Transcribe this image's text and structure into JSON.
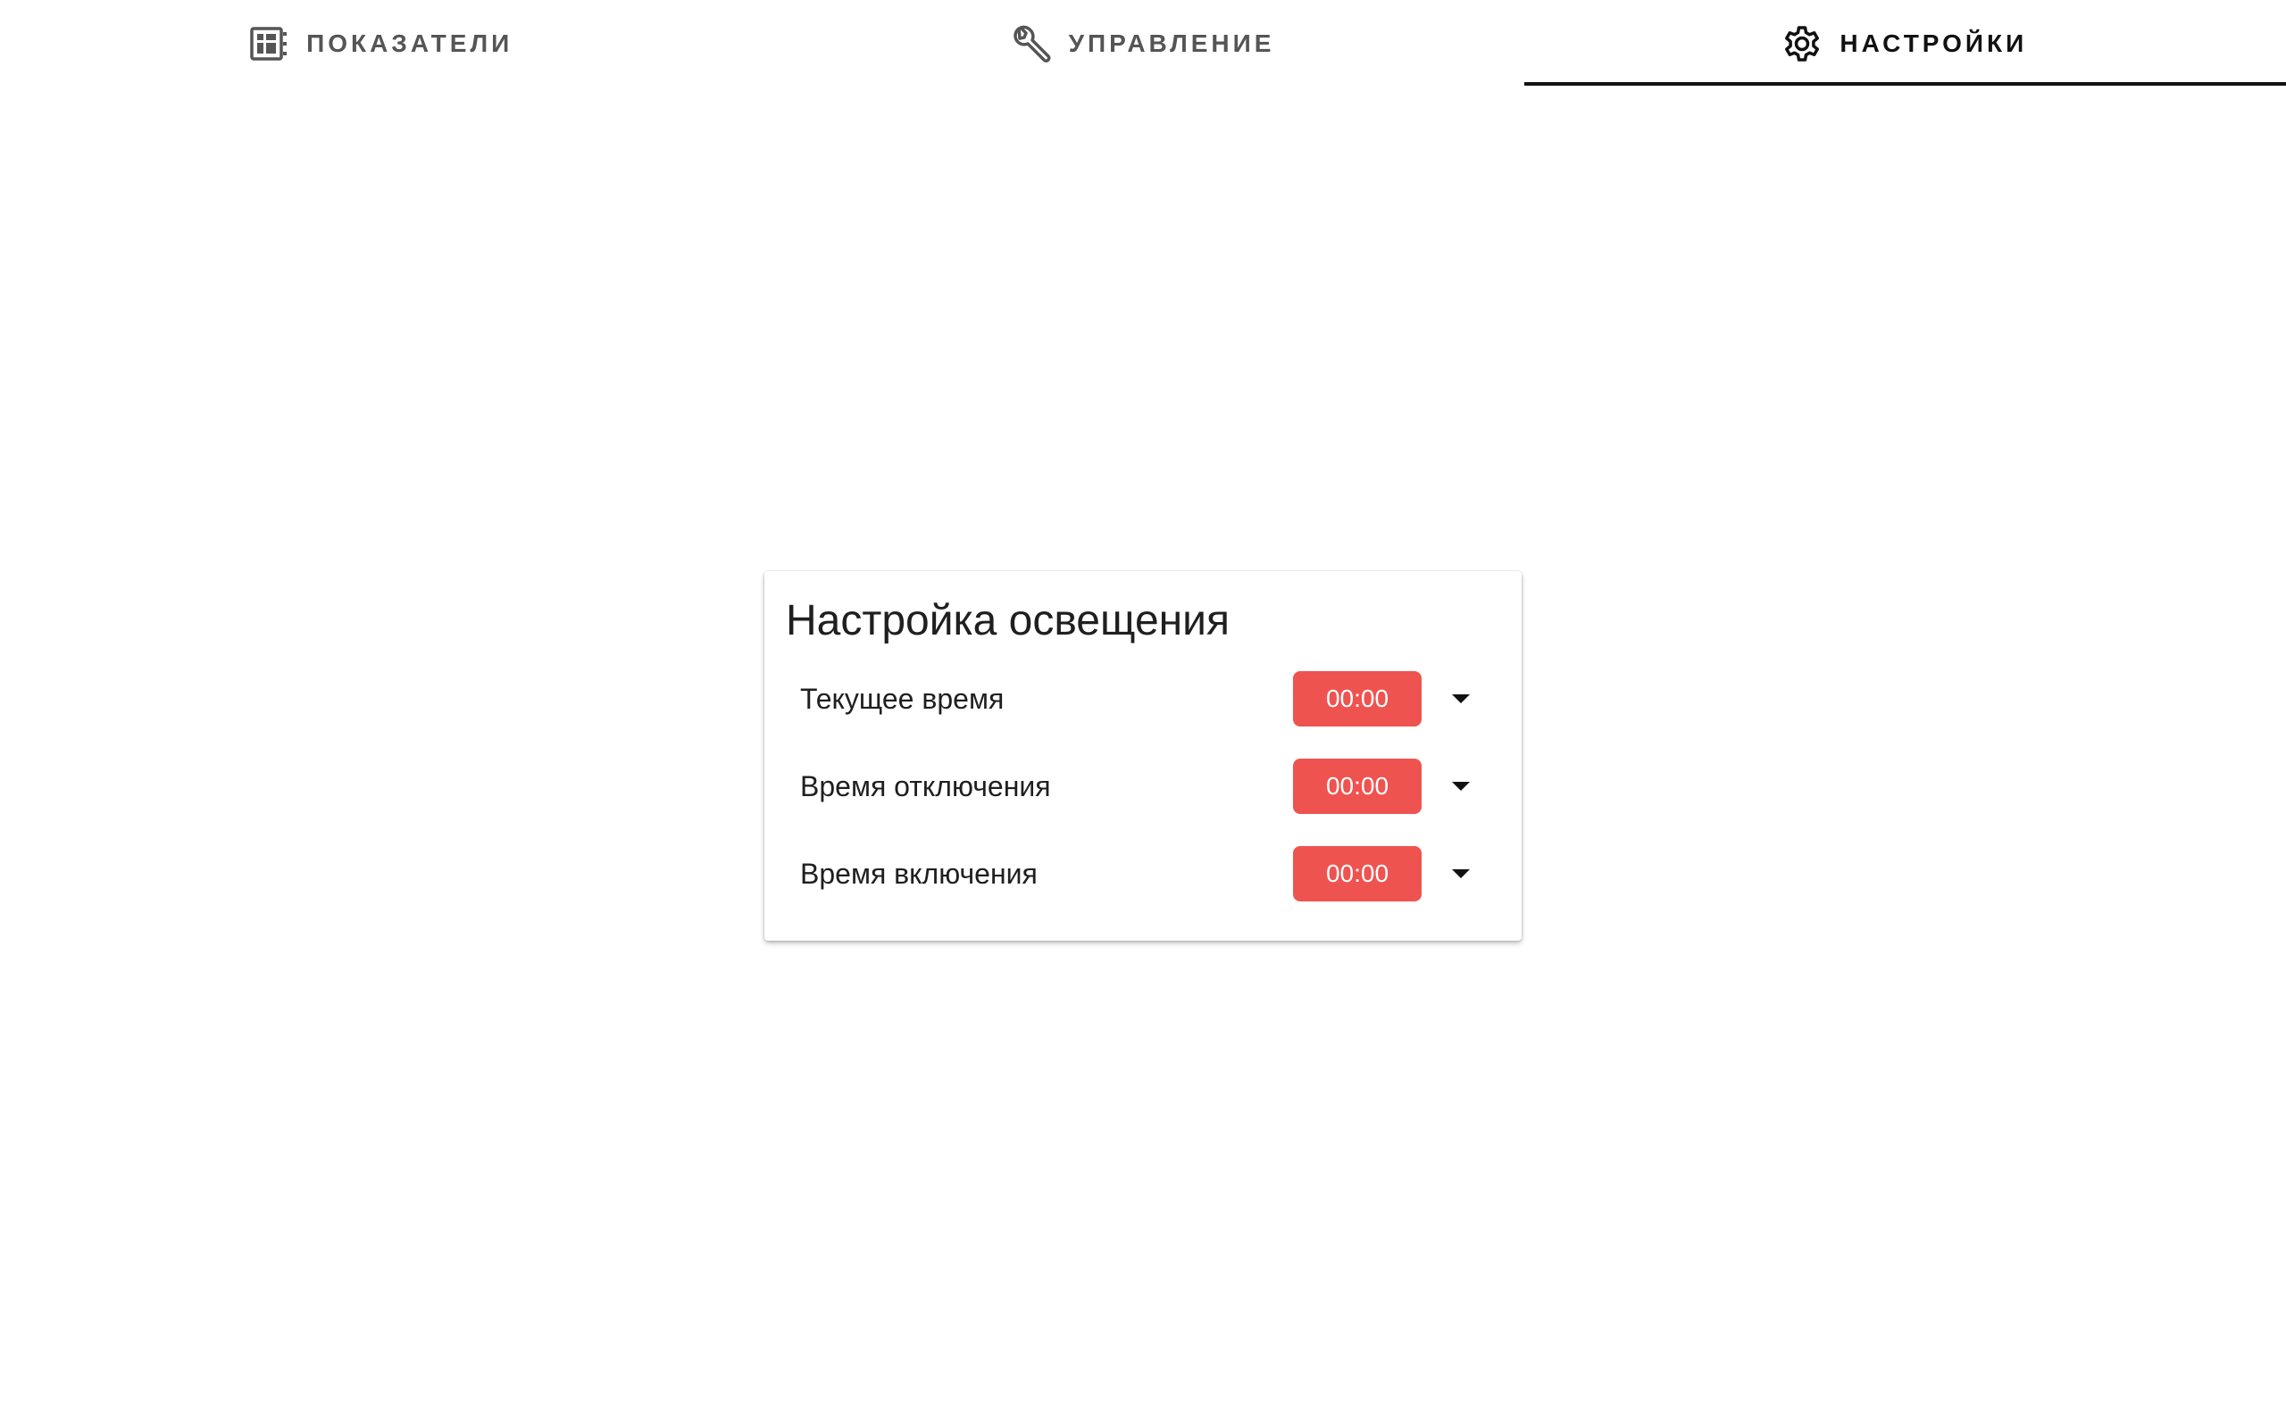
{
  "tabs": [
    {
      "label": "ПОКАЗАТЕЛИ",
      "icon": "dashboard-grid-icon",
      "active": false
    },
    {
      "label": "УПРАВЛЕНИЕ",
      "icon": "wrench-icon",
      "active": false
    },
    {
      "label": "НАСТРОЙКИ",
      "icon": "gear-icon",
      "active": true
    }
  ],
  "lighting_card": {
    "title": "Настройка освещения",
    "rows": [
      {
        "label": "Текущее время",
        "value": "00:00"
      },
      {
        "label": "Время отключения",
        "value": "00:00"
      },
      {
        "label": "Время включения",
        "value": "00:00"
      }
    ]
  },
  "colors": {
    "accent": "#ef5350",
    "active_tab_text": "#111111",
    "inactive_tab_text": "#555555"
  }
}
